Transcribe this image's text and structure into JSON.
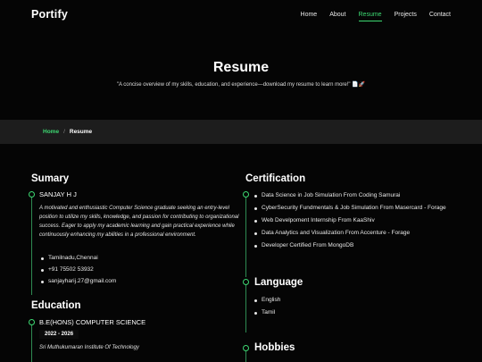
{
  "header": {
    "logo": "Portify",
    "nav": [
      "Home",
      "About",
      "Resume",
      "Projects",
      "Contact"
    ],
    "active_nav": "Resume"
  },
  "hero": {
    "title": "Resume",
    "subtitle": "\"A concise overview of my skills, education, and experience—download my resume to learn more!\" 📄🚀"
  },
  "breadcrumb": {
    "home": "Home",
    "separator": "/",
    "current": "Resume"
  },
  "summary": {
    "title": "Sumary",
    "name": "SANJAY H J",
    "text": "A motivated and enthusiastic Computer Science graduate seeking an entry-level position to utilize my skills, knowledge, and passion for contributing to organizational success. Eager to apply my academic learning and gain practical experience while continuously enhancing my abilities in a professional environment.",
    "contacts": [
      "Tamilnadu,Chennai",
      "+91 75502 53932",
      "sanjayharij.27@gmail.com"
    ]
  },
  "education": {
    "title": "Education",
    "degree": "B.E(HONS) COMPUTER SCIENCE",
    "years": "2022 - 2026",
    "college": "Sri Muthukumaran Institute Of Technology"
  },
  "certification": {
    "title": "Certification",
    "items": [
      "Data Science in Job Simulation From Coding Samurai",
      "CyberSecurity Fundmentals & Job Simulation From Masercard - Forage",
      "Web Develpoment Internship From KaaShiv",
      "Data Analytics and Visualization From Accenture - Forage",
      "Developer Certified From MongoDB"
    ]
  },
  "language": {
    "title": "Language",
    "items": [
      "English",
      "Tamil"
    ]
  },
  "hobbies": {
    "title": "Hobbies"
  },
  "colors": {
    "accent": "#3dd972",
    "background": "#050505",
    "breadcrumb_bar": "#1d1d1d"
  }
}
